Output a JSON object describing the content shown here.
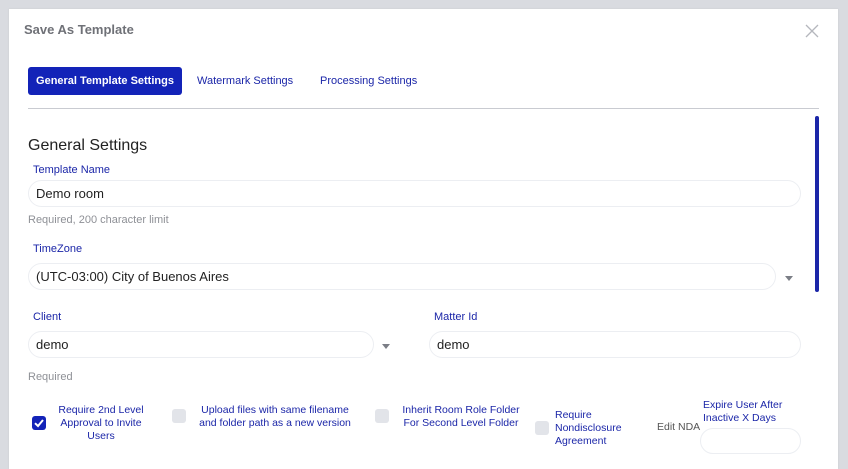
{
  "dialog": {
    "title": "Save As Template"
  },
  "tabs": [
    {
      "label": "General Template Settings",
      "active": true
    },
    {
      "label": "Watermark Settings",
      "active": false
    },
    {
      "label": "Processing Settings",
      "active": false
    }
  ],
  "section_title": "General Settings",
  "template_name": {
    "label": "Template Name",
    "value": "Demo room",
    "help": "Required, 200 character limit"
  },
  "timezone": {
    "label": "TimeZone",
    "value": "(UTC-03:00) City of Buenos Aires"
  },
  "client": {
    "label": "Client",
    "value": "demo",
    "help": "Required"
  },
  "matter": {
    "label": "Matter Id",
    "value": "demo"
  },
  "options": [
    {
      "label": "Require 2nd Level Approval to Invite Users",
      "checked": true
    },
    {
      "label": "Upload files with same filename and folder path as a new version",
      "checked": false
    },
    {
      "label": "Inherit Room Role Folder For Second Level Folder",
      "checked": false
    },
    {
      "label": "Require Nondisclosure Agreement",
      "checked": false
    }
  ],
  "edit_nda": "Edit NDA",
  "expire": {
    "label": "Expire User After Inactive X Days",
    "value": ""
  },
  "colors": {
    "accent": "#1323b8",
    "label": "#1b26a8"
  },
  "icons": {
    "close": "close-icon",
    "dropdown": "chevron-down-icon",
    "check": "check-icon"
  }
}
